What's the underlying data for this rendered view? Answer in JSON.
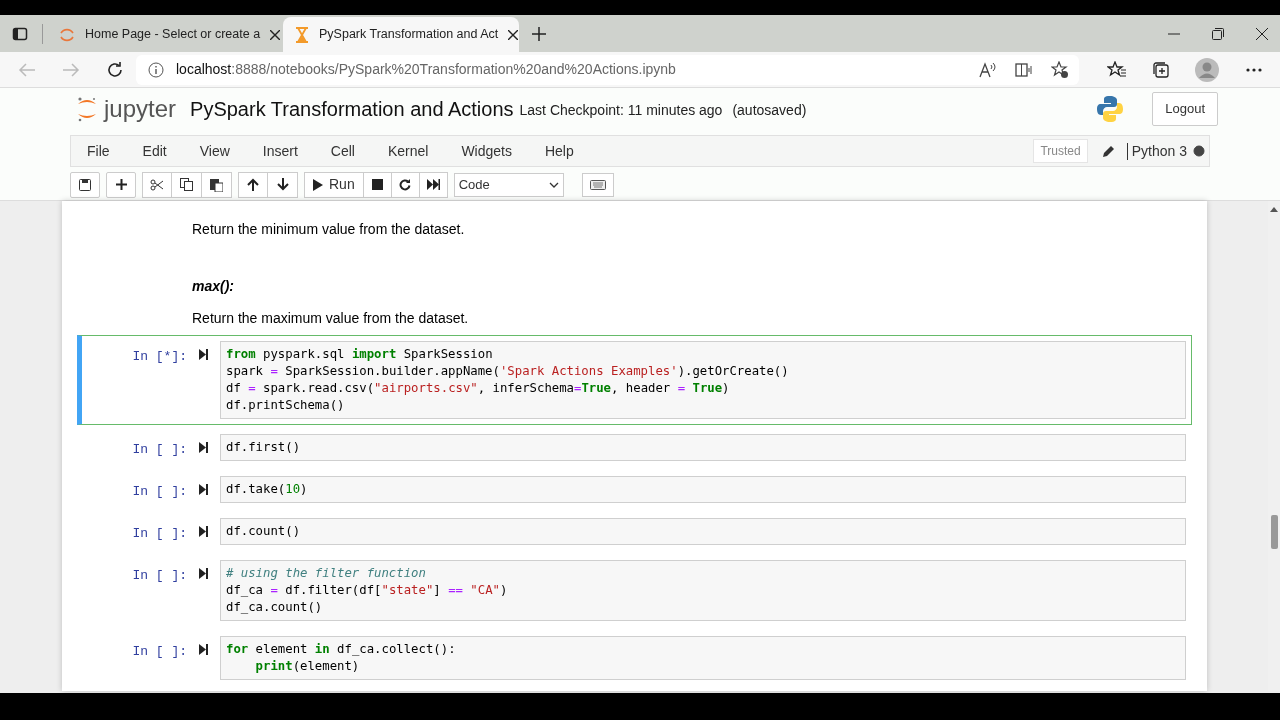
{
  "browser": {
    "tabs": [
      {
        "title": "Home Page - Select or create a",
        "selected": false,
        "kind": "loading"
      },
      {
        "title": "PySpark Transformation and Act",
        "selected": true,
        "kind": "busy"
      }
    ],
    "address": {
      "host": "localhost",
      "path": ":8888/notebooks/PySpark%20Transformation%20and%20Actions.ipynb"
    }
  },
  "notebook": {
    "logo": "jupyter",
    "title": "PySpark Transformation and Actions",
    "checkpoint": "Last Checkpoint: 11 minutes ago",
    "autosave": "(autosaved)",
    "logout": "Logout",
    "menu": [
      "File",
      "Edit",
      "View",
      "Insert",
      "Cell",
      "Kernel",
      "Widgets",
      "Help"
    ],
    "trusted": "Trusted",
    "kernel": "Python 3",
    "kernel_busy": true,
    "run_label": "Run",
    "cell_type": "Code"
  },
  "cells": [
    {
      "kind": "markdown",
      "blocks": [
        {
          "kind": "text",
          "text": "Return the minimum value from the dataset."
        },
        {
          "kind": "heading",
          "text": "max():"
        },
        {
          "kind": "text",
          "text": "Return the maximum value from the dataset."
        }
      ]
    },
    {
      "kind": "code",
      "prompt": "In [*]:",
      "selected": true,
      "lines": [
        [
          {
            "kind": "kw",
            "text": "from"
          },
          {
            "kind": "n",
            "text": " pyspark.sql "
          },
          {
            "kind": "kw",
            "text": "import"
          },
          {
            "kind": "n",
            "text": " SparkSession"
          }
        ],
        [
          {
            "kind": "n",
            "text": "spark "
          },
          {
            "kind": "op",
            "text": "="
          },
          {
            "kind": "n",
            "text": " SparkSession.builder.appName("
          },
          {
            "kind": "str",
            "text": "'Spark Actions Examples'"
          },
          {
            "kind": "n",
            "text": ").getOrCreate()"
          }
        ],
        [
          {
            "kind": "n",
            "text": "df "
          },
          {
            "kind": "op",
            "text": "="
          },
          {
            "kind": "n",
            "text": " spark.read.csv("
          },
          {
            "kind": "str",
            "text": "\"airports.csv\""
          },
          {
            "kind": "n",
            "text": ", inferSchema"
          },
          {
            "kind": "op",
            "text": "="
          },
          {
            "kind": "kw",
            "text": "True"
          },
          {
            "kind": "n",
            "text": ", header "
          },
          {
            "kind": "op",
            "text": "="
          },
          {
            "kind": "kw",
            "text": " True"
          },
          {
            "kind": "n",
            "text": ")"
          }
        ],
        [
          {
            "kind": "n",
            "text": "df.printSchema()"
          }
        ]
      ]
    },
    {
      "kind": "code",
      "prompt": "In [ ]:",
      "selected": false,
      "lines": [
        [
          {
            "kind": "n",
            "text": "df.first()"
          }
        ]
      ]
    },
    {
      "kind": "code",
      "prompt": "In [ ]:",
      "selected": false,
      "lines": [
        [
          {
            "kind": "n",
            "text": "df.take("
          },
          {
            "kind": "num",
            "text": "10"
          },
          {
            "kind": "n",
            "text": ")"
          }
        ]
      ]
    },
    {
      "kind": "code",
      "prompt": "In [ ]:",
      "selected": false,
      "lines": [
        [
          {
            "kind": "n",
            "text": "df.count()"
          }
        ]
      ]
    },
    {
      "kind": "code",
      "prompt": "In [ ]:",
      "selected": false,
      "lines": [
        [
          {
            "kind": "cm",
            "text": "# using the filter function"
          }
        ],
        [
          {
            "kind": "n",
            "text": "df_ca "
          },
          {
            "kind": "op",
            "text": "="
          },
          {
            "kind": "n",
            "text": " df.filter(df["
          },
          {
            "kind": "str",
            "text": "\"state\""
          },
          {
            "kind": "n",
            "text": "] "
          },
          {
            "kind": "op",
            "text": "=="
          },
          {
            "kind": "str",
            "text": " \"CA\""
          },
          {
            "kind": "n",
            "text": ")"
          }
        ],
        [
          {
            "kind": "n",
            "text": "df_ca.count()"
          }
        ]
      ]
    },
    {
      "kind": "code",
      "prompt": "In [ ]:",
      "selected": false,
      "lines": [
        [
          {
            "kind": "kw",
            "text": "for"
          },
          {
            "kind": "n",
            "text": " element "
          },
          {
            "kind": "kw",
            "text": "in"
          },
          {
            "kind": "n",
            "text": " df_ca.collect():"
          }
        ],
        [
          {
            "kind": "kw",
            "text": "    print"
          },
          {
            "kind": "n",
            "text": "(element)"
          }
        ]
      ]
    }
  ]
}
